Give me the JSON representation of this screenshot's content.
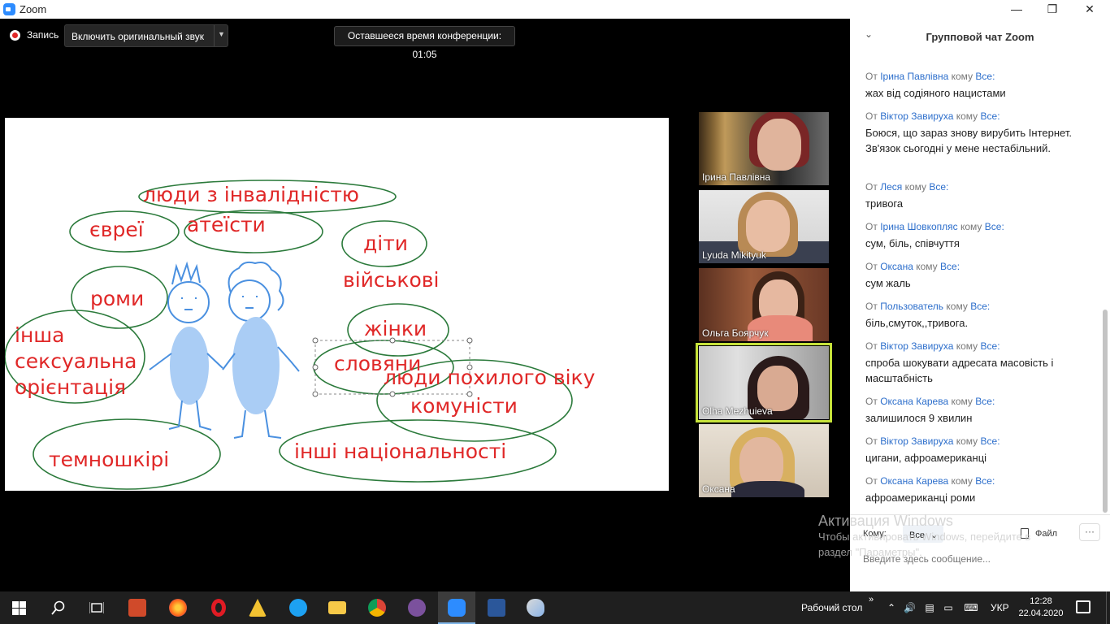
{
  "window": {
    "title": "Zoom",
    "minimize": "—",
    "maximize": "❐",
    "close": "✕"
  },
  "toolbar": {
    "record_label": "Запись",
    "original_sound_label": "Включить оригинальный звук",
    "original_sound_arrow": "▼",
    "timer_label": "Оставшееся время конференции: 01:05"
  },
  "slide": {
    "words": [
      "люди з інвалідністю",
      "євреї",
      "атеїсти",
      "діти",
      "військові",
      "роми",
      "інша",
      "сексуальна",
      "орієнтація",
      "жінки",
      "словяни",
      "люди похилого віку",
      "комуністи",
      "темношкірі",
      "інші національності"
    ],
    "colors": {
      "text": "#e02828",
      "ellipse": "#2b7a3b",
      "figure": "#4a90e0",
      "body_fill": "#aacdf5"
    }
  },
  "participants": [
    {
      "name": "Ірина Павлівна"
    },
    {
      "name": "Lyuda Mikityuk"
    },
    {
      "name": "Ольга Боярчук"
    },
    {
      "name": "Olha Mezhuieva",
      "active": true
    },
    {
      "name": "Оксана"
    }
  ],
  "watermark": {
    "line1": "Активация Windows",
    "line2": "Чтобы активировать Windows, перейдите в",
    "line3": "раздел \"Параметры\"."
  },
  "chat": {
    "title": "Групповой чат Zoom",
    "collapse_icon": "chevron-down",
    "prefix_from": "От",
    "prefix_to": "кому",
    "messages": [
      {
        "from": "Ірина Павлівна",
        "to": "Все:",
        "text": "жах від содіяного нацистами"
      },
      {
        "from": "Віктор Завируха",
        "to": "Все:",
        "text": "Боюся, що зараз знову вирубить Інтернет. Зв'язок сьогодні у мене нестабільний."
      },
      {
        "from": "Леся",
        "to": "Все:",
        "text": "тривога"
      },
      {
        "from": "Ірина Шовкопляс",
        "to": "Все:",
        "text": "сум, біль, співчуття"
      },
      {
        "from": "Оксана",
        "to": "Все:",
        "text": "сум жаль"
      },
      {
        "from": "Пользователь",
        "to": "Все:",
        "text": "біль,смуток,,тривога."
      },
      {
        "from": "Віктор Завируха",
        "to": "Все:",
        "text": "спроба шокувати адресата масовість і  масштабність"
      },
      {
        "from": "Оксана Карева",
        "to": "Все:",
        "text": "залишилося 9 хвилин"
      },
      {
        "from": "Віктор Завируха",
        "to": "Все:",
        "text": "цигани, афроамериканці"
      },
      {
        "from": "Оксана Карева",
        "to": "Все:",
        "text": "афроамериканці роми"
      }
    ],
    "to_label": "Кому:",
    "to_value": "Все",
    "file_label": "Файл",
    "more_label": "···",
    "input_placeholder": "Введите здесь сообщение..."
  },
  "taskbar": {
    "apps": [
      "windows-start",
      "search",
      "task-view",
      "powerpoint",
      "firefox",
      "opera",
      "autocad",
      "skype",
      "file-explorer",
      "chrome",
      "viber",
      "zoom",
      "word",
      "paint"
    ],
    "desktop_label": "Рабочий стол",
    "desktop_arrow": "»",
    "lang": "УКР",
    "time": "12:28",
    "date": "22.04.2020"
  }
}
